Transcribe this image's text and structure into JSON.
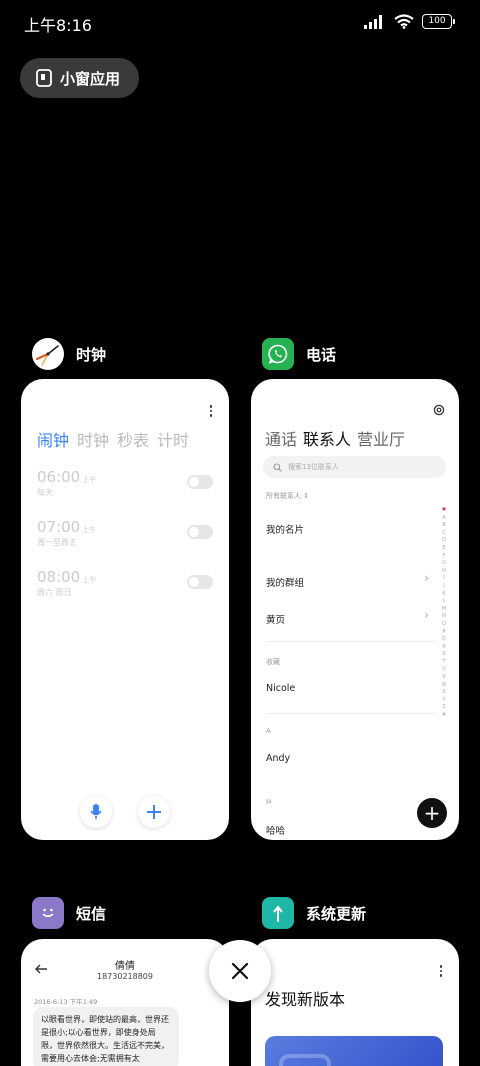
{
  "status_bar": {
    "time": "上午8:16",
    "battery": "100"
  },
  "small_window": {
    "label": "小窗应用"
  },
  "clock_app": {
    "name": "时钟",
    "tabs": [
      "闹钟",
      "时钟",
      "秒表",
      "计时"
    ],
    "alarms": [
      {
        "time": "06:00",
        "ampm": "上午",
        "repeat": "每天"
      },
      {
        "time": "07:00",
        "ampm": "上午",
        "repeat": "周一至周五"
      },
      {
        "time": "08:00",
        "ampm": "上午",
        "repeat": "周六 周日"
      }
    ]
  },
  "phone_app": {
    "name": "电话",
    "tabs": [
      "通话",
      "联系人",
      "营业厅"
    ],
    "search_placeholder": "搜索13位联系人",
    "all_contacts": "所有联系人",
    "my_card": "我的名片",
    "my_groups": "我的群组",
    "yellow_pages": "黄页",
    "favorites_label": "收藏",
    "favorite_contact": "Nicole",
    "section_a": "A",
    "contact_a": "Andy",
    "section_h": "H",
    "contact_h": "哈哈",
    "alphabet": [
      "♥",
      "A",
      "B",
      "C",
      "D",
      "E",
      "F",
      "G",
      "H",
      "I",
      "J",
      "K",
      "L",
      "M",
      "N",
      "O",
      "P",
      "Q",
      "R",
      "S",
      "T",
      "U",
      "V",
      "W",
      "X",
      "Y",
      "Z",
      "#"
    ]
  },
  "sms_app": {
    "name": "短信",
    "contact_name": "倩倩",
    "contact_number": "18730218809",
    "date": "2016-6-13 下午1:49",
    "message": "以眼看世界，即使站的最高，世界还是很小;以心看世界，即使身处局限，世界依然很大。生活远不完美，需要用心去体会;无需拥有太"
  },
  "update_app": {
    "name": "系统更新",
    "title": "发现新版本"
  },
  "colors": {
    "accent": "#3b82f6",
    "whatsapp": "#25b252",
    "sms": "#8a78c9",
    "update": "#1fb8a6"
  }
}
